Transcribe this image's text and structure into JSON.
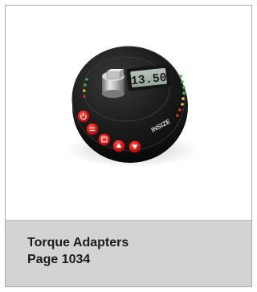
{
  "product": {
    "title": "Torque Adapters",
    "page_ref": "Page 1034",
    "display_value": "13.50",
    "brand_logo_text": "INSIZE"
  },
  "icons": {
    "power": "power-icon",
    "unit": "unit-icon",
    "memory": "memory-icon",
    "up": "arrow-up-icon",
    "down": "arrow-down-icon"
  },
  "colors": {
    "card_border": "#a9a9a9",
    "caption_bg": "#d3d3d3",
    "caption_text": "#1c1c1c",
    "body_dark": "#181818",
    "button_red": "#d21a1a",
    "lcd": "#a4b0a6",
    "led_green": "#3fbf3f",
    "led_yellow": "#e8c73a",
    "led_red": "#d83a2a"
  }
}
